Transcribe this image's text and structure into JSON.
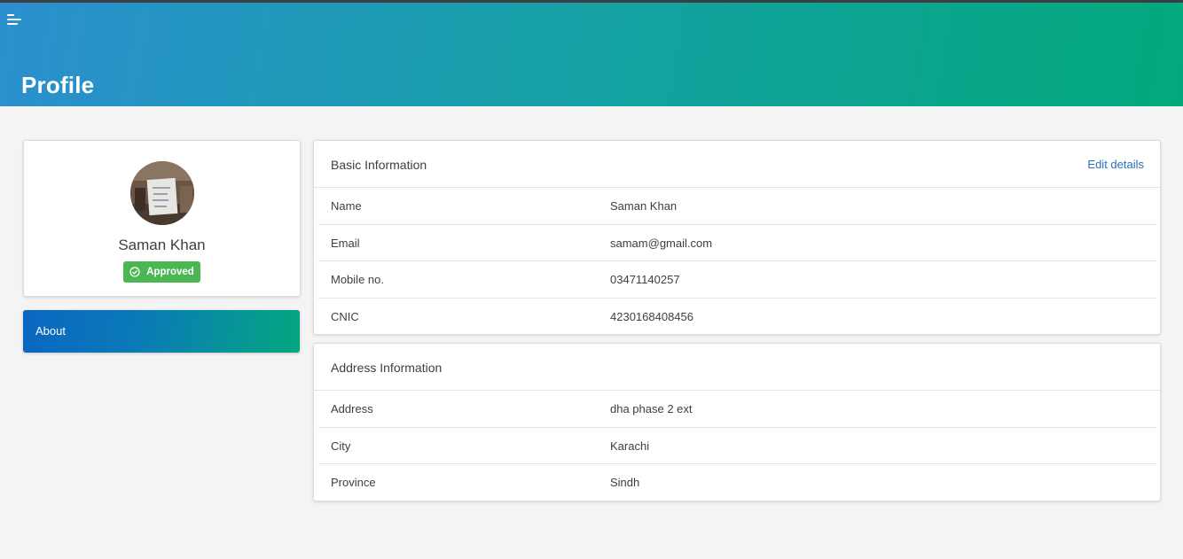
{
  "header": {
    "title": "Profile",
    "menu_icon": "hamburger-menu-icon"
  },
  "profile": {
    "name": "Saman Khan",
    "status": "Approved",
    "status_icon": "check-circle-icon",
    "status_color": "#4cb652"
  },
  "sidebar": {
    "about_label": "About"
  },
  "basic_information": {
    "title": "Basic Information",
    "edit_label": "Edit details",
    "rows": [
      {
        "label": "Name",
        "value": "Saman Khan"
      },
      {
        "label": "Email",
        "value": "samam@gmail.com"
      },
      {
        "label": "Mobile no.",
        "value": "03471140257"
      },
      {
        "label": "CNIC",
        "value": "4230168408456"
      }
    ]
  },
  "address_information": {
    "title": "Address Information",
    "rows": [
      {
        "label": "Address",
        "value": "dha phase 2 ext"
      },
      {
        "label": "City",
        "value": "Karachi"
      },
      {
        "label": "Province",
        "value": "Sindh"
      }
    ]
  },
  "colors": {
    "header_gradient_start": "#2b8fcf",
    "header_gradient_end": "#03a97c",
    "link": "#2a6ebb"
  }
}
